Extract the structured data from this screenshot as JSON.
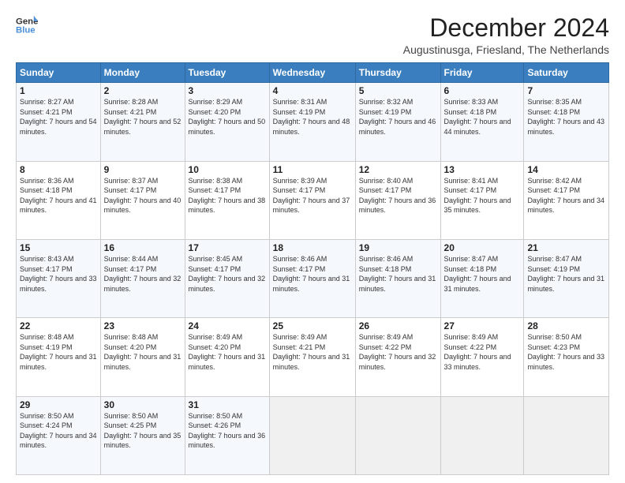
{
  "header": {
    "logo_line1": "General",
    "logo_line2": "Blue",
    "title": "December 2024",
    "subtitle": "Augustinusga, Friesland, The Netherlands"
  },
  "columns": [
    "Sunday",
    "Monday",
    "Tuesday",
    "Wednesday",
    "Thursday",
    "Friday",
    "Saturday"
  ],
  "weeks": [
    [
      {
        "day": "1",
        "sunrise": "8:27 AM",
        "sunset": "4:21 PM",
        "daylight": "7 hours and 54 minutes."
      },
      {
        "day": "2",
        "sunrise": "8:28 AM",
        "sunset": "4:21 PM",
        "daylight": "7 hours and 52 minutes."
      },
      {
        "day": "3",
        "sunrise": "8:29 AM",
        "sunset": "4:20 PM",
        "daylight": "7 hours and 50 minutes."
      },
      {
        "day": "4",
        "sunrise": "8:31 AM",
        "sunset": "4:19 PM",
        "daylight": "7 hours and 48 minutes."
      },
      {
        "day": "5",
        "sunrise": "8:32 AM",
        "sunset": "4:19 PM",
        "daylight": "7 hours and 46 minutes."
      },
      {
        "day": "6",
        "sunrise": "8:33 AM",
        "sunset": "4:18 PM",
        "daylight": "7 hours and 44 minutes."
      },
      {
        "day": "7",
        "sunrise": "8:35 AM",
        "sunset": "4:18 PM",
        "daylight": "7 hours and 43 minutes."
      }
    ],
    [
      {
        "day": "8",
        "sunrise": "8:36 AM",
        "sunset": "4:18 PM",
        "daylight": "7 hours and 41 minutes."
      },
      {
        "day": "9",
        "sunrise": "8:37 AM",
        "sunset": "4:17 PM",
        "daylight": "7 hours and 40 minutes."
      },
      {
        "day": "10",
        "sunrise": "8:38 AM",
        "sunset": "4:17 PM",
        "daylight": "7 hours and 38 minutes."
      },
      {
        "day": "11",
        "sunrise": "8:39 AM",
        "sunset": "4:17 PM",
        "daylight": "7 hours and 37 minutes."
      },
      {
        "day": "12",
        "sunrise": "8:40 AM",
        "sunset": "4:17 PM",
        "daylight": "7 hours and 36 minutes."
      },
      {
        "day": "13",
        "sunrise": "8:41 AM",
        "sunset": "4:17 PM",
        "daylight": "7 hours and 35 minutes."
      },
      {
        "day": "14",
        "sunrise": "8:42 AM",
        "sunset": "4:17 PM",
        "daylight": "7 hours and 34 minutes."
      }
    ],
    [
      {
        "day": "15",
        "sunrise": "8:43 AM",
        "sunset": "4:17 PM",
        "daylight": "7 hours and 33 minutes."
      },
      {
        "day": "16",
        "sunrise": "8:44 AM",
        "sunset": "4:17 PM",
        "daylight": "7 hours and 32 minutes."
      },
      {
        "day": "17",
        "sunrise": "8:45 AM",
        "sunset": "4:17 PM",
        "daylight": "7 hours and 32 minutes."
      },
      {
        "day": "18",
        "sunrise": "8:46 AM",
        "sunset": "4:17 PM",
        "daylight": "7 hours and 31 minutes."
      },
      {
        "day": "19",
        "sunrise": "8:46 AM",
        "sunset": "4:18 PM",
        "daylight": "7 hours and 31 minutes."
      },
      {
        "day": "20",
        "sunrise": "8:47 AM",
        "sunset": "4:18 PM",
        "daylight": "7 hours and 31 minutes."
      },
      {
        "day": "21",
        "sunrise": "8:47 AM",
        "sunset": "4:19 PM",
        "daylight": "7 hours and 31 minutes."
      }
    ],
    [
      {
        "day": "22",
        "sunrise": "8:48 AM",
        "sunset": "4:19 PM",
        "daylight": "7 hours and 31 minutes."
      },
      {
        "day": "23",
        "sunrise": "8:48 AM",
        "sunset": "4:20 PM",
        "daylight": "7 hours and 31 minutes."
      },
      {
        "day": "24",
        "sunrise": "8:49 AM",
        "sunset": "4:20 PM",
        "daylight": "7 hours and 31 minutes."
      },
      {
        "day": "25",
        "sunrise": "8:49 AM",
        "sunset": "4:21 PM",
        "daylight": "7 hours and 31 minutes."
      },
      {
        "day": "26",
        "sunrise": "8:49 AM",
        "sunset": "4:22 PM",
        "daylight": "7 hours and 32 minutes."
      },
      {
        "day": "27",
        "sunrise": "8:49 AM",
        "sunset": "4:22 PM",
        "daylight": "7 hours and 33 minutes."
      },
      {
        "day": "28",
        "sunrise": "8:50 AM",
        "sunset": "4:23 PM",
        "daylight": "7 hours and 33 minutes."
      }
    ],
    [
      {
        "day": "29",
        "sunrise": "8:50 AM",
        "sunset": "4:24 PM",
        "daylight": "7 hours and 34 minutes."
      },
      {
        "day": "30",
        "sunrise": "8:50 AM",
        "sunset": "4:25 PM",
        "daylight": "7 hours and 35 minutes."
      },
      {
        "day": "31",
        "sunrise": "8:50 AM",
        "sunset": "4:26 PM",
        "daylight": "7 hours and 36 minutes."
      },
      null,
      null,
      null,
      null
    ]
  ],
  "labels": {
    "sunrise": "Sunrise:",
    "sunset": "Sunset:",
    "daylight": "Daylight:"
  }
}
